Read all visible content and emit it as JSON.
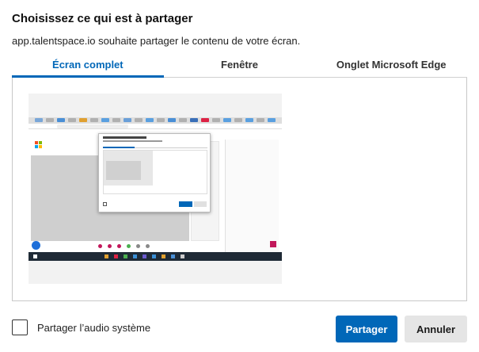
{
  "dialog": {
    "title": "Choisissez ce qui est à partager",
    "subtitle": "app.talentspace.io souhaite partager le contenu de votre écran."
  },
  "tabs": [
    {
      "label": "Écran complet",
      "active": true
    },
    {
      "label": "Fenêtre",
      "active": false
    },
    {
      "label": "Onglet Microsoft Edge",
      "active": false
    }
  ],
  "preview": {
    "icon": "screen-thumbnail"
  },
  "audio": {
    "label": "Partager l’audio système",
    "checked": false
  },
  "buttons": {
    "share": "Partager",
    "cancel": "Annuler"
  },
  "colors": {
    "accent": "#0067b8",
    "secondary_button": "#e5e5e5"
  }
}
